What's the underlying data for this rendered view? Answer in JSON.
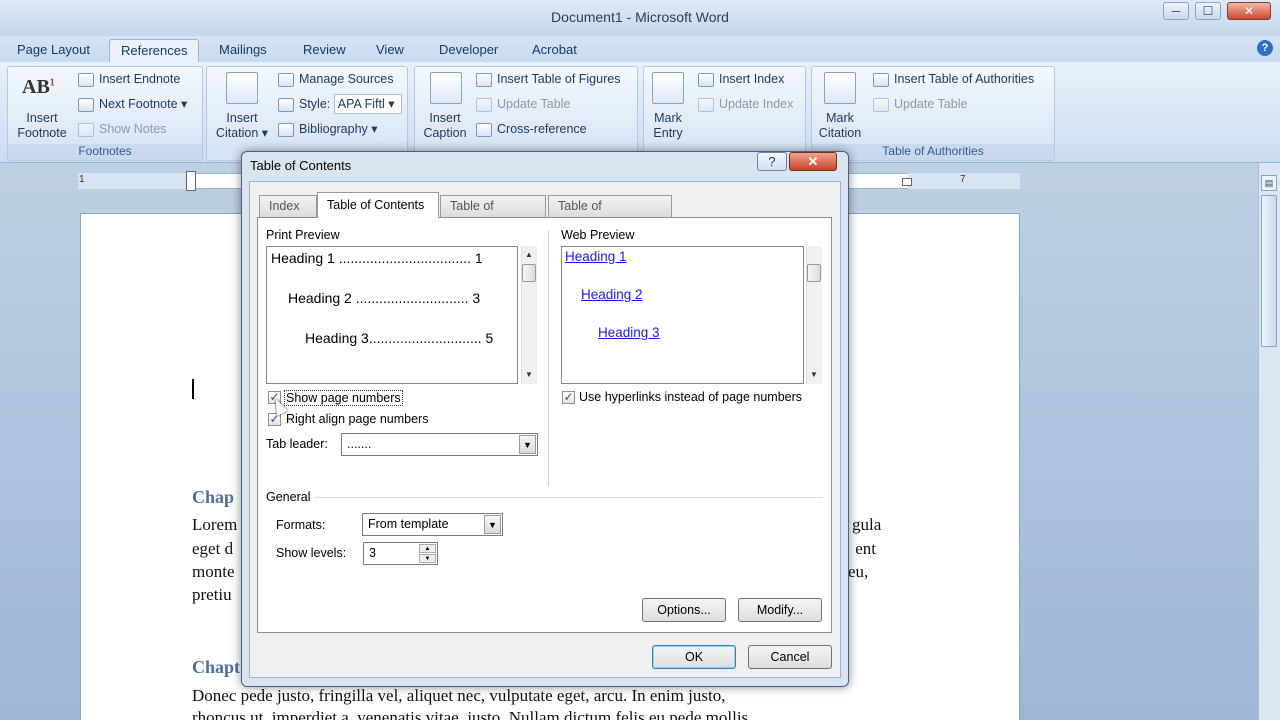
{
  "window": {
    "title": "Document1 - Microsoft Word",
    "min": "─",
    "max": "☐",
    "close": "✕"
  },
  "ribbon_tabs": [
    "Page Layout",
    "References",
    "Mailings",
    "Review",
    "View",
    "Developer",
    "Acrobat"
  ],
  "active_tab": "References",
  "ribbon": {
    "footnotes": {
      "label": "Footnotes",
      "insert_footnote": "Insert\nFootnote",
      "insert_footnote_l1": "Insert",
      "insert_footnote_l2": "Footnote",
      "insert_endnote": "Insert Endnote",
      "next_footnote": "Next Footnote",
      "show_notes": "Show Notes"
    },
    "citations": {
      "insert_citation_l1": "Insert",
      "insert_citation_l2": "Citation",
      "manage_sources": "Manage Sources",
      "style_label": "Style:",
      "style_value": "APA Fiftl",
      "bibliography": "Bibliography"
    },
    "captions": {
      "insert_caption_l1": "Insert",
      "insert_caption_l2": "Caption",
      "insert_table_of_figures": "Insert Table of Figures",
      "update_table": "Update Table",
      "cross_reference": "Cross-reference"
    },
    "index": {
      "mark_entry_l1": "Mark",
      "mark_entry_l2": "Entry",
      "insert_index": "Insert Index",
      "update_index": "Update Index"
    },
    "authorities": {
      "label": "Table of Authorities",
      "mark_citation_l1": "Mark",
      "mark_citation_l2": "Citation",
      "insert_table_of_authorities": "Insert Table of Authorities",
      "update_table": "Update Table"
    }
  },
  "ruler": {
    "left_num": "1",
    "right_num": "7"
  },
  "document": {
    "chapter1_heading": "Chap",
    "chapter1_lines_left": [
      "Lorem",
      "eget d",
      "monte",
      "pretiu"
    ],
    "chapter1_lines_right": [
      "gula",
      "ent",
      "eu,",
      ""
    ],
    "chapter2_heading": "Chapt",
    "chapter2_line1": "Donec pede justo, fringilla vel, aliquet nec, vulputate eget, arcu. In enim justo,",
    "chapter2_line2": "rhoncus ut, imperdiet a, venenatis vitae, justo. Nullam dictum felis eu pede mollis"
  },
  "dialog": {
    "title": "Table of Contents",
    "help": "?",
    "close": "✕",
    "tabs": [
      "Index",
      "Table of Contents",
      "Table of Figures",
      "Table of Authorities"
    ],
    "active_tab": "Table of Contents",
    "print_preview_label": "Print Preview",
    "print_preview": [
      {
        "text": "Heading 1 .................................. 1"
      },
      {
        "text": "Heading 2 ............................. 3"
      },
      {
        "text": "Heading 3............................. 5"
      }
    ],
    "show_page_numbers": {
      "label": "Show page numbers",
      "checked": true
    },
    "right_align": {
      "label": "Right align page numbers",
      "checked": true
    },
    "tab_leader": {
      "label": "Tab leader:",
      "value": "......."
    },
    "web_preview_label": "Web Preview",
    "web_preview": [
      "Heading 1",
      "Heading 2",
      "Heading 3"
    ],
    "use_hyperlinks": {
      "label": "Use hyperlinks instead of page numbers",
      "checked": true
    },
    "general_label": "General",
    "formats": {
      "label": "Formats:",
      "value": "From template"
    },
    "show_levels": {
      "label": "Show levels:",
      "value": "3"
    },
    "options_button": "Options...",
    "modify_button": "Modify...",
    "ok_button": "OK",
    "cancel_button": "Cancel"
  }
}
